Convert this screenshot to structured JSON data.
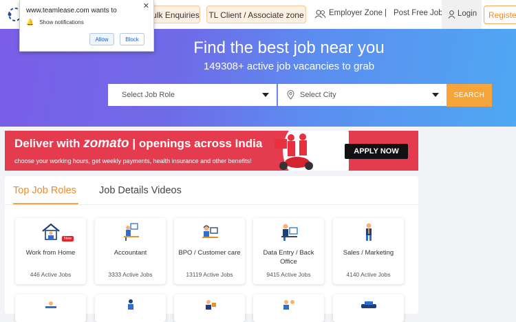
{
  "header": {
    "buttons": [
      "Bulk Enquiries",
      "TL Client / Associate zone"
    ],
    "nav": [
      "Employer Zone",
      "|",
      "Post Free Job"
    ],
    "login": "Login",
    "register": "Register"
  },
  "notification": {
    "title": "www.teamlease.com wants to",
    "message": "Show notifications",
    "allow": "Allow",
    "block": "Block"
  },
  "hero": {
    "title": "Find the best job near you",
    "subtitle": "149308+ active job vacancies to grab",
    "job_role_placeholder": "Select Job Role",
    "city_placeholder": "Select City",
    "search": "SEARCH"
  },
  "banner": {
    "prefix": "Deliver with ",
    "brand": "zomato",
    "suffix": " | openings across India",
    "sub": "choose your working hours, get weekly payments, health insurance and other benefits!",
    "cta": "APPLY NOW"
  },
  "roles": {
    "tabs": [
      "Top Job Roles",
      "Job Details Videos"
    ],
    "new_badge": "New",
    "cards": [
      {
        "title": "Work from Home",
        "count": "446 Active Jobs",
        "icon": "home-office-icon"
      },
      {
        "title": "Accountant",
        "count": "3333 Active Jobs",
        "icon": "accountant-icon"
      },
      {
        "title": "BPO / Customer care",
        "count": "13119 Active Jobs",
        "icon": "headset-agent-icon"
      },
      {
        "title": "Data Entry / Back Office",
        "count": "9415 Active Jobs",
        "icon": "data-entry-icon"
      },
      {
        "title": "Sales / Marketing",
        "count": "4140 Active Jobs",
        "icon": "salesperson-icon"
      }
    ]
  },
  "colors": {
    "accent": "#f6a53a",
    "brand_red": "#e43c4e",
    "hero_start": "#7a5ee8",
    "hero_end": "#4fa8f3"
  }
}
